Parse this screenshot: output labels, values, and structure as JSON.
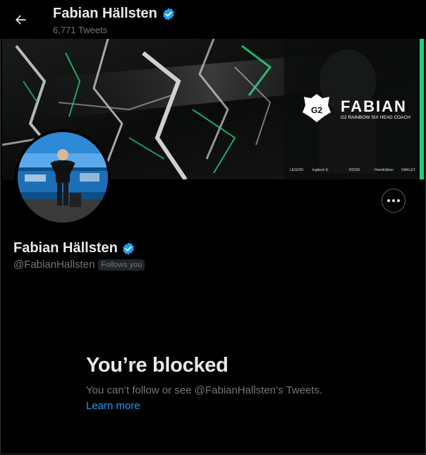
{
  "header": {
    "name": "Fabian Hällsten",
    "tweet_count": "6,771 Tweets"
  },
  "banner": {
    "brand_text": "FABIAN",
    "brand_subtitle": "G2 RAINBOW SIX HEAD COACH",
    "sponsors": [
      "LEGION",
      "logitech G",
      "ROON",
      "HenrikSkinn",
      "OAKLEY"
    ]
  },
  "profile": {
    "name": "Fabian Hällsten",
    "handle": "@FabianHallsten",
    "follows_badge": "Follows you"
  },
  "blocked": {
    "title": "You’re blocked",
    "message": "You can’t follow or see @FabianHallsten’s Tweets.",
    "learn_more": "Learn more"
  },
  "colors": {
    "background": "#000000",
    "accent": "#1d9bf0",
    "secondary_text": "#71767b",
    "banner_stripe": "#1fd17a"
  },
  "icons": {
    "back": "arrow-left-icon",
    "verified": "verified-badge-icon",
    "more": "more-dots-icon"
  }
}
